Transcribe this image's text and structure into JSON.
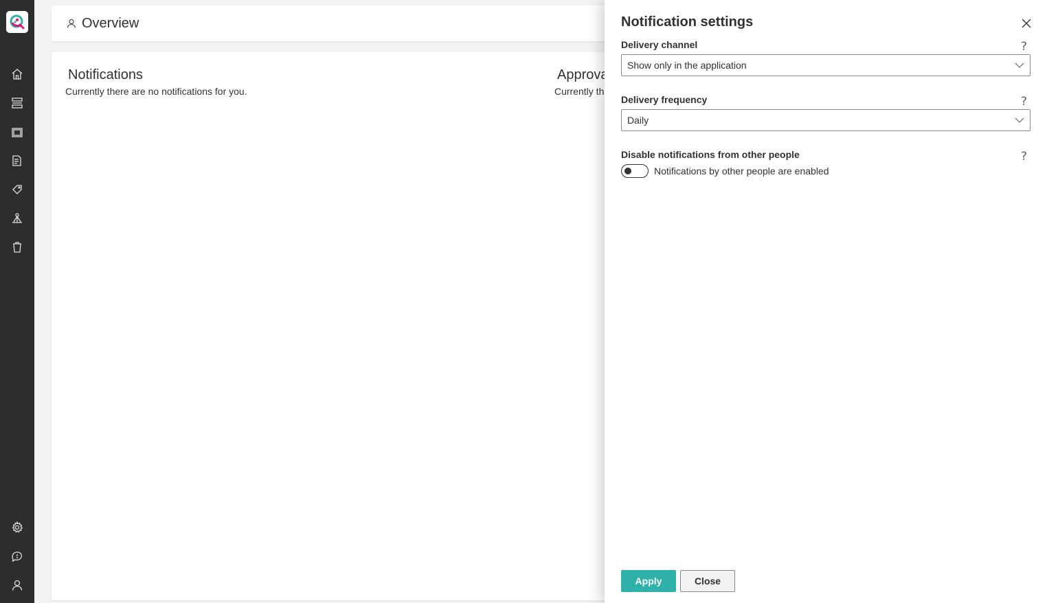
{
  "header": {
    "title": "Overview"
  },
  "sections": {
    "notifications": {
      "title": "Notifications",
      "text": "Currently there are no notifications for you."
    },
    "approvals": {
      "title": "Approva",
      "text": "Currently th"
    }
  },
  "panel": {
    "title": "Notification settings",
    "delivery_channel": {
      "label": "Delivery channel",
      "value": "Show only in the application"
    },
    "delivery_frequency": {
      "label": "Delivery frequency",
      "value": "Daily"
    },
    "disable_others": {
      "label": "Disable notifications from other people",
      "toggle_text": "Notifications by other people are enabled",
      "enabled": false
    },
    "help_glyph": "?",
    "apply_label": "Apply",
    "close_label": "Close"
  },
  "colors": {
    "rail": "#2d2d2d",
    "accent": "#2fb0a8",
    "logo_pink": "#e3157a",
    "logo_teal": "#2fb0a8"
  },
  "icons": {
    "rail_top": [
      "home-icon",
      "layers-icon",
      "window-icon",
      "report-icon",
      "tag-icon",
      "hierarchy-icon",
      "trash-icon"
    ],
    "rail_bottom": [
      "gear-icon",
      "chat-icon",
      "user-icon"
    ]
  }
}
